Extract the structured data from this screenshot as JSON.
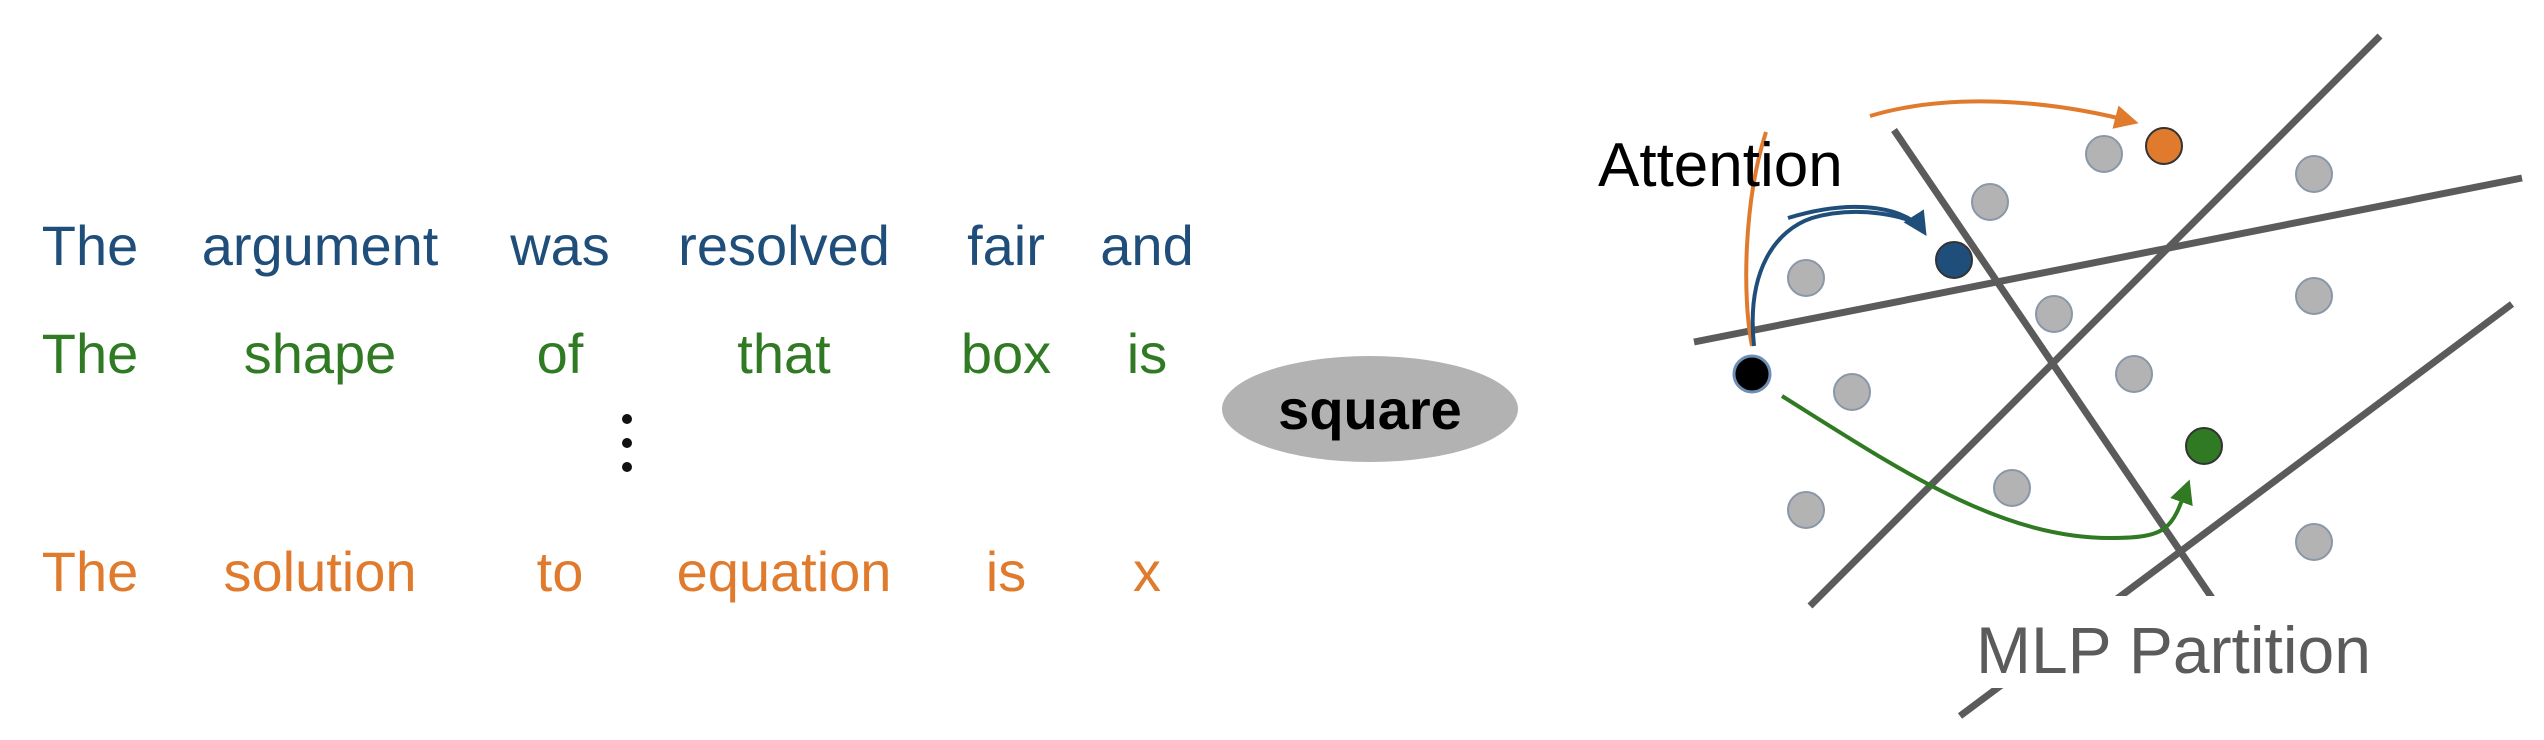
{
  "sentences": [
    {
      "color": "#1f4e7a",
      "words": [
        "The",
        "argument",
        "was",
        "resolved",
        "fair",
        "and"
      ]
    },
    {
      "color": "#2f7a22",
      "words": [
        "The",
        "shape",
        "of",
        "that",
        "box",
        "is"
      ]
    },
    {
      "color": "#e07b2e",
      "words": [
        "The",
        "solution",
        "to",
        "equation",
        "is",
        "x"
      ]
    }
  ],
  "output_token": "square",
  "labels": {
    "attention": "Attention",
    "mlp": "MLP Partition"
  },
  "colors": {
    "blue": "#1f4e7a",
    "green": "#2f7a22",
    "orange": "#e07b2e",
    "gray_point": "#b3b3b3",
    "partition_line": "#5b5b5b",
    "query_point": "#000000"
  }
}
